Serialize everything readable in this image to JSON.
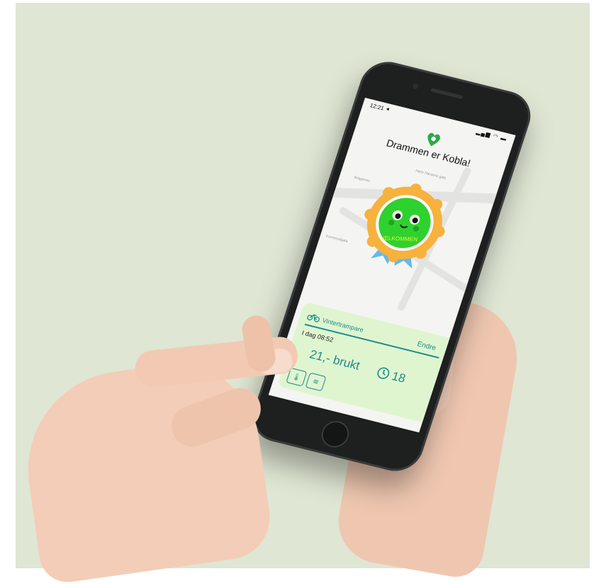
{
  "status_bar": {
    "time": "12:21 ⯇",
    "icons": "▂▄▆ ◠ ▬"
  },
  "app": {
    "title": "Drammen er Kobla!"
  },
  "badge": {
    "text": "VELKOMMEN"
  },
  "card": {
    "plan_name": "Vintertrampare",
    "edit_label": "Endre",
    "time": "I dag 08:52",
    "price": "21,- brukt",
    "timer": "18"
  },
  "colors": {
    "accent": "#1a8c8c",
    "badge_green": "#2fd12f",
    "badge_orange": "#f6b23c",
    "card_bg": "#dff5d0",
    "backdrop": "#dfe6d3"
  },
  "icons": [
    "bicycle-icon",
    "clock-icon",
    "thermometer-snow-icon",
    "wind-icon",
    "heart-pin-logo"
  ]
}
